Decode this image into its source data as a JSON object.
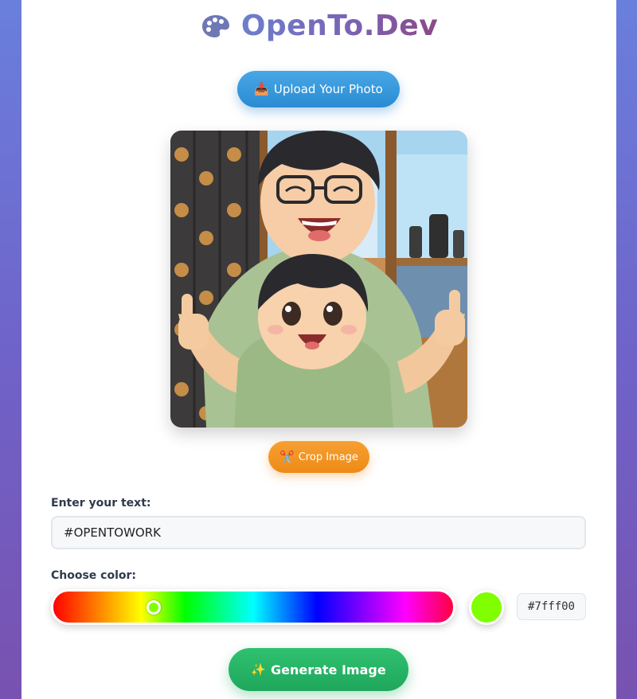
{
  "app": {
    "title": "OpenTo.Dev",
    "logo_icon": "palette-icon"
  },
  "upload": {
    "icon": "inbox-tray-icon",
    "icon_glyph": "📥",
    "label": "Upload Your Photo"
  },
  "photo": {
    "alt": "Anime style illustration of a smiling man with glasses and a child giving thumbs up"
  },
  "crop": {
    "icon": "scissors-icon",
    "icon_glyph": "✂️",
    "label": "Crop Image"
  },
  "text_field": {
    "label": "Enter your text:",
    "value": "#OPENTOWORK"
  },
  "color_field": {
    "label": "Choose color:",
    "hue_fraction": 0.25,
    "selected_color": "#7fff00",
    "hex_text": "#7fff00"
  },
  "generate": {
    "icon": "sparkles-icon",
    "icon_glyph": "✨",
    "label": "Generate Image"
  },
  "colors": {
    "upload_button": "#2a8bd2",
    "crop_button": "#ee8a16",
    "generate_button": "#1fa75c"
  }
}
